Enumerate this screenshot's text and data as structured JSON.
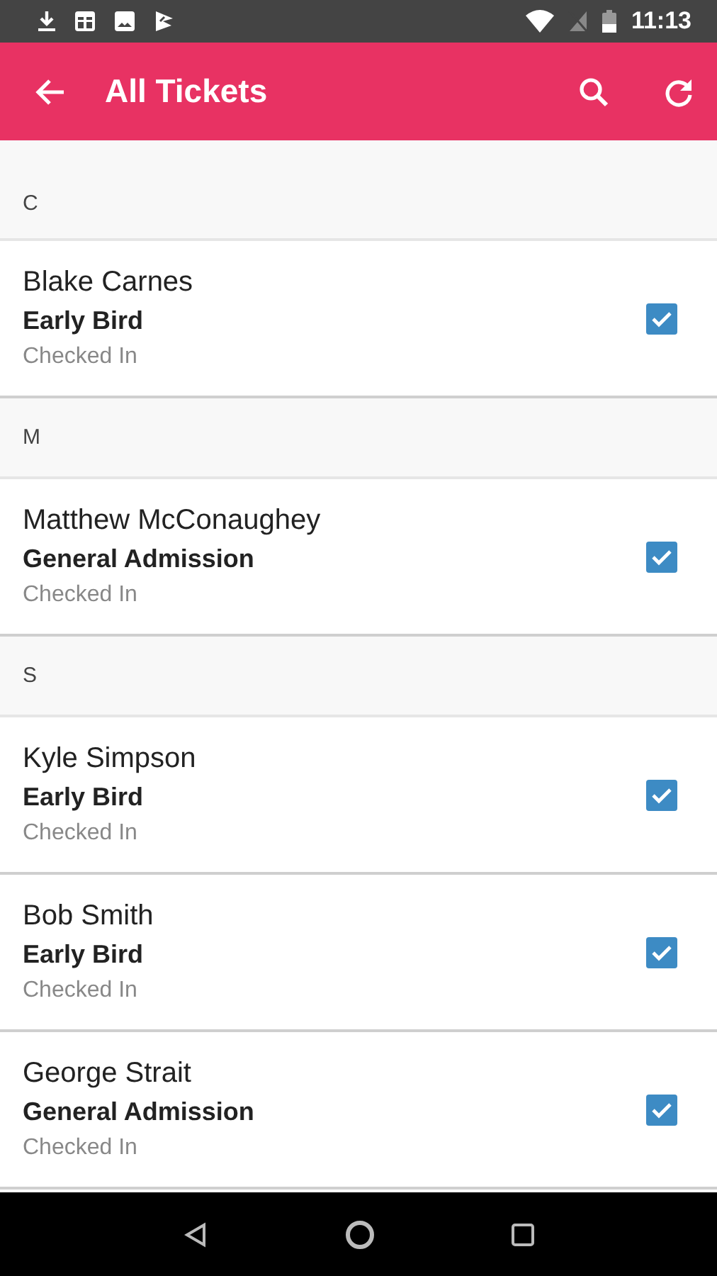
{
  "status_bar": {
    "time": "11:13"
  },
  "app_bar": {
    "title": "All Tickets"
  },
  "sections": [
    {
      "letter": "C",
      "tickets": [
        {
          "name": "Blake Carnes",
          "ticket_type": "Early Bird",
          "status": "Checked In",
          "checked": true
        }
      ]
    },
    {
      "letter": "M",
      "tickets": [
        {
          "name": "Matthew McConaughey",
          "ticket_type": "General Admission",
          "status": "Checked In",
          "checked": true
        }
      ]
    },
    {
      "letter": "S",
      "tickets": [
        {
          "name": "Kyle Simpson",
          "ticket_type": "Early Bird",
          "status": "Checked In",
          "checked": true
        },
        {
          "name": "Bob Smith",
          "ticket_type": "Early Bird",
          "status": "Checked In",
          "checked": true
        },
        {
          "name": "George Strait",
          "ticket_type": "General Admission",
          "status": "Checked In",
          "checked": true
        }
      ]
    }
  ]
}
